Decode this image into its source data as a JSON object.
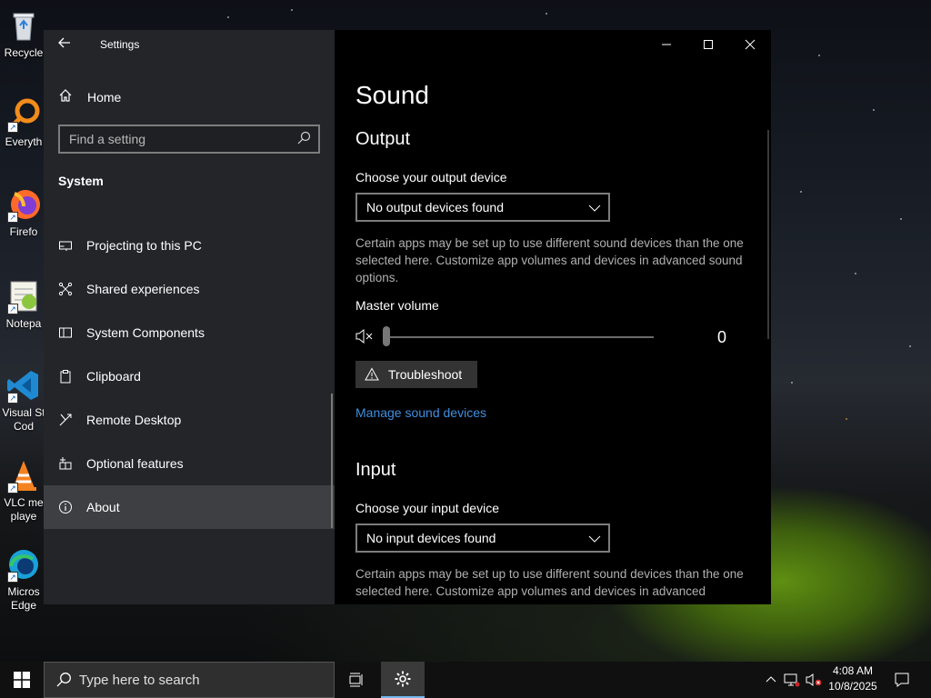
{
  "desktop": {
    "icons": [
      {
        "label": "Recycle",
        "icon": "recycle-bin-icon"
      },
      {
        "label": "Everyth",
        "icon": "everything-search-icon"
      },
      {
        "label": "Firefo",
        "icon": "firefox-icon"
      },
      {
        "label": "Notepa",
        "icon": "notepad-plus-plus-icon"
      },
      {
        "label": "Visual St",
        "label2": "Cod",
        "icon": "vscode-icon"
      },
      {
        "label": "VLC me",
        "label2": "playe",
        "icon": "vlc-icon"
      },
      {
        "label": "Micros",
        "label2": "Edge",
        "icon": "edge-icon"
      }
    ]
  },
  "window": {
    "title": "Settings",
    "back_icon": "back-arrow-icon",
    "caption": {
      "minimize": "minimize-icon",
      "maximize": "maximize-icon",
      "close": "close-icon"
    }
  },
  "sidebar": {
    "home_label": "Home",
    "search_placeholder": "Find a setting",
    "section_title": "System",
    "items": [
      {
        "label": "Projecting to this PC",
        "icon": "projector-icon"
      },
      {
        "label": "Shared experiences",
        "icon": "shared-experiences-icon"
      },
      {
        "label": "System Components",
        "icon": "system-components-icon"
      },
      {
        "label": "Clipboard",
        "icon": "clipboard-icon"
      },
      {
        "label": "Remote Desktop",
        "icon": "remote-desktop-icon"
      },
      {
        "label": "Optional features",
        "icon": "optional-features-icon"
      },
      {
        "label": "About",
        "icon": "info-icon",
        "selected": true
      }
    ]
  },
  "sound": {
    "page_title": "Sound",
    "output": {
      "heading": "Output",
      "device_label": "Choose your output device",
      "device_value": "No output devices found",
      "description": "Certain apps may be set up to use different sound devices than the one selected here. Customize app volumes and devices in advanced sound options.",
      "volume_label": "Master volume",
      "volume_value": "0",
      "volume_level": 0,
      "troubleshoot_label": "Troubleshoot",
      "manage_link": "Manage sound devices"
    },
    "input": {
      "heading": "Input",
      "device_label": "Choose your input device",
      "device_value": "No input devices found",
      "description": "Certain apps may be set up to use different sound devices than the one selected here. Customize app volumes and devices in advanced"
    }
  },
  "taskbar": {
    "search_placeholder": "Type here to search",
    "time": "4:08 AM",
    "date": "10/8/2025",
    "accent": "#76b9ed"
  }
}
